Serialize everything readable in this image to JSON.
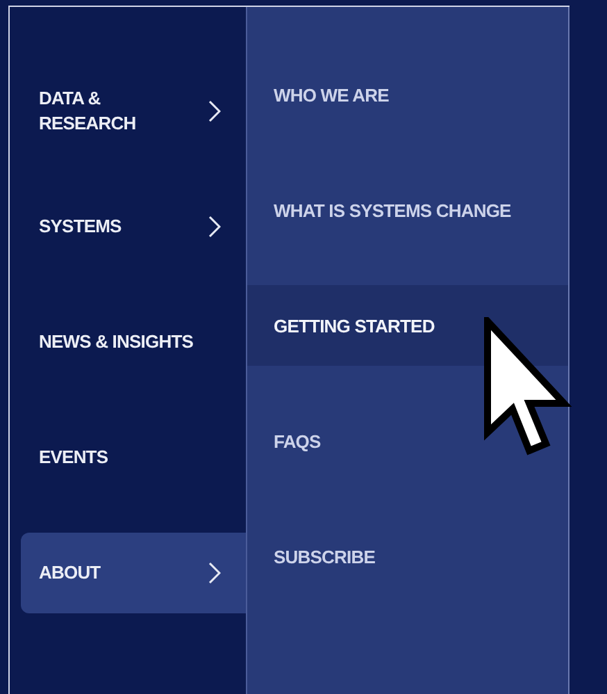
{
  "main_menu": [
    {
      "label": "DATA &\nRESEARCH",
      "has_submenu": true,
      "selected": false
    },
    {
      "label": "SYSTEMS",
      "has_submenu": true,
      "selected": false
    },
    {
      "label": "NEWS & INSIGHTS",
      "has_submenu": false,
      "selected": false
    },
    {
      "label": "EVENTS",
      "has_submenu": false,
      "selected": false
    },
    {
      "label": "ABOUT",
      "has_submenu": true,
      "selected": true
    }
  ],
  "submenu": [
    {
      "label": "WHO WE ARE",
      "selected": false
    },
    {
      "label": "WHAT IS SYSTEMS CHANGE",
      "selected": false
    },
    {
      "label": "GETTING STARTED",
      "selected": true
    },
    {
      "label": "FAQS",
      "selected": false
    },
    {
      "label": "SUBSCRIBE",
      "selected": false
    }
  ]
}
